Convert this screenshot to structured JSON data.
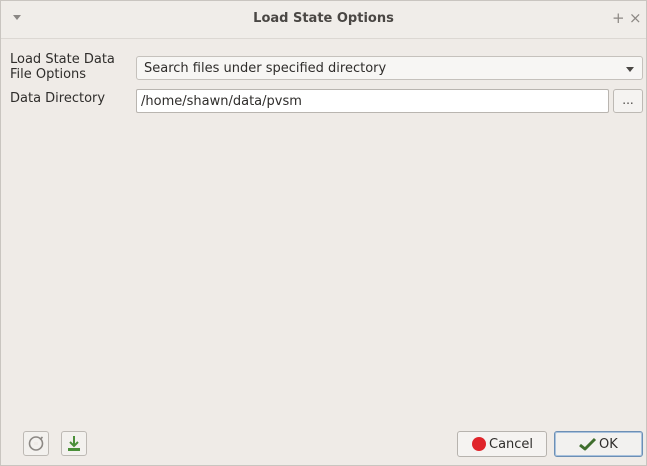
{
  "window": {
    "title": "Load State Options",
    "controls": {
      "pin": "+",
      "close": "×"
    }
  },
  "form": {
    "data_file_options_label_line1": "Load State Data",
    "data_file_options_label_line2": "File Options",
    "data_file_options_value": "Search files under specified directory",
    "data_directory_label": "Data Directory",
    "data_directory_value": "/home/shawn/data/pvsm",
    "browse_label": "..."
  },
  "footer": {
    "cancel_label": "Cancel",
    "ok_label": "OK",
    "left_icons": [
      "reset-icon",
      "save-default-icon"
    ]
  },
  "colors": {
    "window_bg": "#efebe7",
    "cancel_icon": "#e0242a",
    "ok_border": "#6c8fb5"
  }
}
